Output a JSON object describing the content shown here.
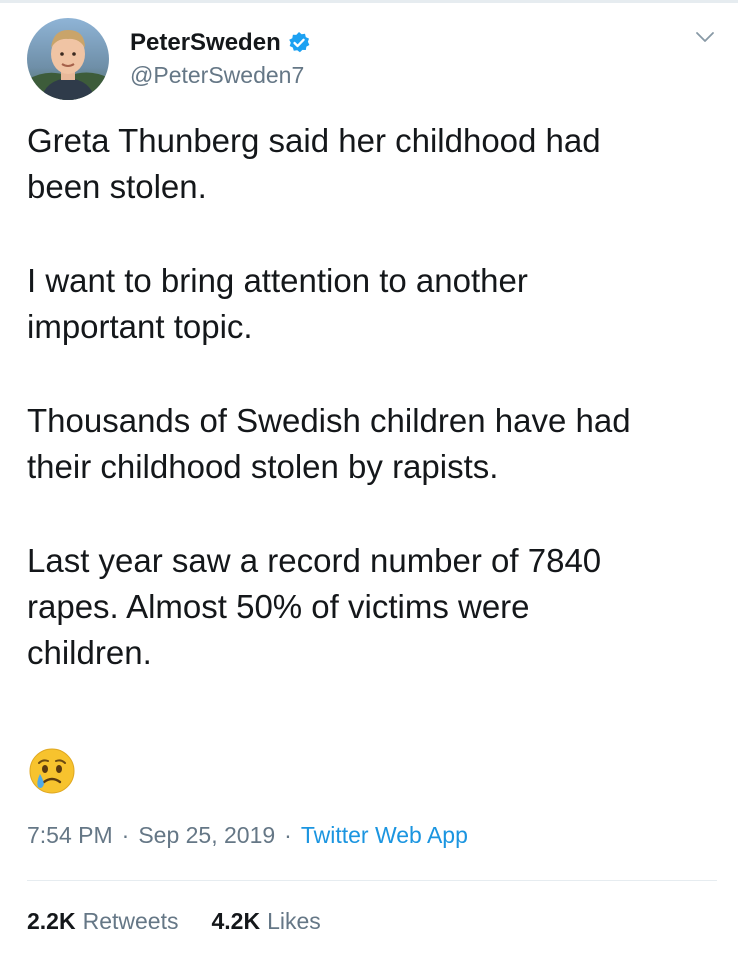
{
  "author": {
    "display_name": "PeterSweden",
    "handle": "@PeterSweden7",
    "verified": true,
    "avatar_icon": "profile-photo"
  },
  "tweet": {
    "paragraphs": [
      "Greta Thunberg said her childhood had\nbeen stolen.",
      "I want to bring attention to another\nimportant topic.",
      "Thousands of Swedish children have had\ntheir childhood stolen by rapists.",
      "Last year saw a record number of 7840\nrapes. Almost 50% of victims were\nchildren."
    ],
    "emoji": "crying-face"
  },
  "meta": {
    "time": "7:54 PM",
    "date": "Sep 25, 2019",
    "source": "Twitter Web App",
    "separator": "·"
  },
  "stats": {
    "retweets_count": "2.2K",
    "retweets_label": "Retweets",
    "likes_count": "4.2K",
    "likes_label": "Likes"
  },
  "colors": {
    "verified_badge": "#1da1f2",
    "link": "#1b95e0",
    "secondary_text": "#657786",
    "primary_text": "#14171a",
    "divider": "#e6ecf0"
  }
}
